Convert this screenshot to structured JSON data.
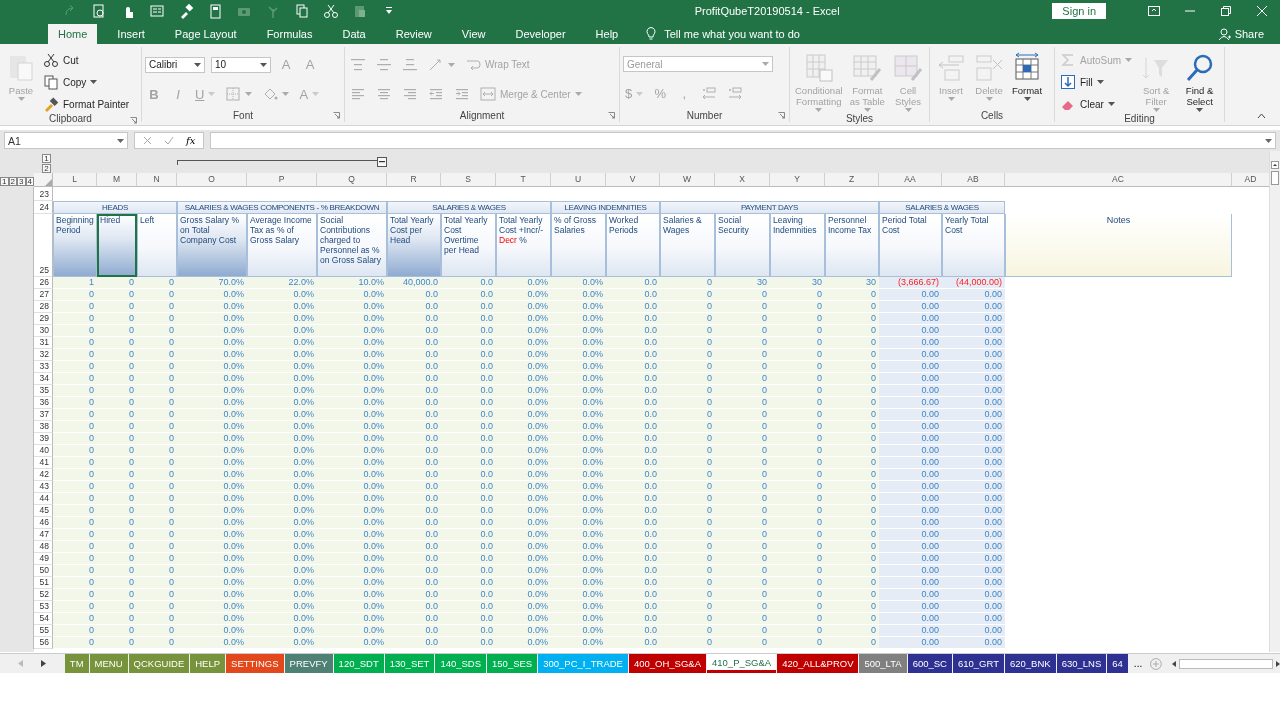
{
  "title_bar": {
    "title": "ProfitQubeT20190514  -  Excel",
    "sign_in": "Sign in"
  },
  "menu_tabs": [
    {
      "label": "Home",
      "selected": true
    },
    {
      "label": "Insert",
      "selected": false
    },
    {
      "label": "Page Layout",
      "selected": false
    },
    {
      "label": "Formulas",
      "selected": false
    },
    {
      "label": "Data",
      "selected": false
    },
    {
      "label": "Review",
      "selected": false
    },
    {
      "label": "View",
      "selected": false
    },
    {
      "label": "Developer",
      "selected": false
    },
    {
      "label": "Help",
      "selected": false
    }
  ],
  "tell_me": "Tell me what you want to do",
  "share": "Share",
  "ribbon": {
    "groups": [
      {
        "label": "Clipboard",
        "lines": [
          [
            {
              "kind": "large",
              "label": "Paste",
              "dropdown": true,
              "disabled": true
            }
          ],
          [
            {
              "kind": "small",
              "label": "Cut",
              "dropdown": false,
              "disabled": false
            },
            {
              "kind": "small",
              "label": "Copy",
              "dropdown": true,
              "disabled": false
            },
            {
              "kind": "small",
              "label": "Format Painter",
              "dropdown": false,
              "disabled": false
            }
          ]
        ]
      },
      {
        "label": "Font",
        "lines": [
          [
            {
              "kind": "field",
              "label": "Calibri",
              "dropdown": true,
              "disabled": false
            },
            {
              "kind": "field",
              "label": "10",
              "dropdown": true,
              "disabled": false
            },
            {
              "kind": "glyph",
              "label": "A",
              "dropdown": false,
              "disabled": true
            },
            {
              "kind": "glyph",
              "label": "A",
              "dropdown": false,
              "disabled": true
            }
          ],
          [
            {
              "kind": "glyph",
              "label": "B",
              "dropdown": false,
              "disabled": true
            },
            {
              "kind": "glyph",
              "label": "I",
              "dropdown": false,
              "disabled": true
            },
            {
              "kind": "glyph",
              "label": "U",
              "dropdown": true,
              "disabled": true
            },
            {
              "kind": "icon",
              "dropdown": true,
              "disabled": true
            },
            {
              "kind": "icon",
              "dropdown": true,
              "disabled": true
            },
            {
              "kind": "glyph",
              "label": "A",
              "dropdown": true,
              "disabled": true
            }
          ]
        ]
      },
      {
        "label": "Alignment",
        "lines": [
          [
            {
              "kind": "icon",
              "dropdown": false,
              "disabled": true
            },
            {
              "kind": "icon",
              "dropdown": false,
              "disabled": true
            },
            {
              "kind": "icon",
              "dropdown": false,
              "disabled": true
            },
            {
              "kind": "icon",
              "dropdown": true,
              "disabled": true
            },
            {
              "kind": "small",
              "label": "Wrap Text",
              "dropdown": false,
              "disabled": true
            }
          ],
          [
            {
              "kind": "icon",
              "dropdown": false,
              "disabled": true
            },
            {
              "kind": "icon",
              "dropdown": false,
              "disabled": true
            },
            {
              "kind": "icon",
              "dropdown": false,
              "disabled": true
            },
            {
              "kind": "icon",
              "dropdown": false,
              "disabled": true
            },
            {
              "kind": "icon",
              "dropdown": false,
              "disabled": true
            },
            {
              "kind": "small",
              "label": "Merge & Center",
              "dropdown": true,
              "disabled": true
            }
          ]
        ]
      },
      {
        "label": "Number",
        "lines": [
          [
            {
              "kind": "field",
              "label": "General",
              "dropdown": true,
              "disabled": true
            }
          ],
          [
            {
              "kind": "glyph",
              "label": "$",
              "dropdown": true,
              "disabled": true
            },
            {
              "kind": "glyph",
              "label": "%",
              "dropdown": false,
              "disabled": true
            },
            {
              "kind": "glyph",
              "label": ",",
              "dropdown": false,
              "disabled": true
            },
            {
              "kind": "icon",
              "dropdown": false,
              "disabled": true
            },
            {
              "kind": "icon",
              "dropdown": false,
              "disabled": true
            }
          ]
        ]
      },
      {
        "label": "Styles",
        "lines": [
          [
            {
              "kind": "large",
              "label": "Conditional Formatting",
              "dropdown": true,
              "disabled": true
            }
          ],
          [
            {
              "kind": "large",
              "label": "Format as Table",
              "dropdown": true,
              "disabled": true
            }
          ],
          [
            {
              "kind": "large",
              "label": "Cell Styles",
              "dropdown": true,
              "disabled": true
            }
          ]
        ]
      },
      {
        "label": "Cells",
        "lines": [
          [
            {
              "kind": "large",
              "label": "Insert",
              "dropdown": true,
              "disabled": true
            }
          ],
          [
            {
              "kind": "large",
              "label": "Delete",
              "dropdown": true,
              "disabled": true
            }
          ],
          [
            {
              "kind": "large",
              "label": "Format",
              "dropdown": true,
              "disabled": false
            }
          ]
        ]
      },
      {
        "label": "Editing",
        "lines": [
          [
            {
              "kind": "small",
              "label": "AutoSum",
              "dropdown": true,
              "disabled": true
            },
            {
              "kind": "small",
              "label": "Fill",
              "dropdown": true,
              "disabled": false
            },
            {
              "kind": "small",
              "label": "Clear",
              "dropdown": true,
              "disabled": false
            }
          ],
          [
            {
              "kind": "large",
              "label": "Sort & Filter",
              "dropdown": true,
              "disabled": true
            }
          ],
          [
            {
              "kind": "large",
              "label": "Find & Select",
              "dropdown": true,
              "disabled": false
            }
          ]
        ]
      }
    ]
  },
  "formula_bar": {
    "name_box": "A1",
    "fx": "fx"
  },
  "sheet": {
    "column_outline_levels": [
      "1",
      "2"
    ],
    "row_outline_levels": [
      "1",
      "2",
      "3",
      "4"
    ],
    "columns": [
      "L",
      "M",
      "N",
      "O",
      "P",
      "Q",
      "R",
      "S",
      "T",
      "U",
      "V",
      "W",
      "X",
      "Y",
      "Z",
      "AA",
      "AB",
      "AC",
      "AD"
    ],
    "empty_rows": [
      "23"
    ],
    "band_row": "24",
    "bands": [
      "HEADS",
      "SALARIES & WAGES COMPONENTS - % BREAKDOWN",
      "SALARIES & WAGES",
      "LEAVING INDEMNITIES",
      "PAYMENT DAYS",
      "SALARIES & WAGES"
    ],
    "header_row": "25",
    "headers": [
      {
        "label": "Beginning Period",
        "shaded": true,
        "selected": false
      },
      {
        "label": "Hired",
        "shaded": true,
        "selected": true
      },
      {
        "label": "Left",
        "shaded": false,
        "selected": false
      },
      {
        "label": "Gross Salary % on Total Company Cost",
        "shaded": true,
        "selected": false
      },
      {
        "label": "Average Income Tax as % of Gross Salary",
        "shaded": false,
        "selected": false
      },
      {
        "label": "Social Contributions charged to Personnel as % on Gross Salary",
        "shaded": false,
        "selected": false
      },
      {
        "label": "Total Yearly Cost per Head",
        "shaded": true,
        "selected": false
      },
      {
        "label": "Total Yearly Cost Overtime per Head",
        "shaded": false,
        "selected": false
      },
      {
        "label": "Total Yearly Cost +Incr/-",
        "alert": "Decr",
        "suffix": " %",
        "shaded": false,
        "selected": false
      },
      {
        "label": "% of Gross Salaries",
        "shaded": false,
        "selected": false
      },
      {
        "label": "Worked Periods",
        "shaded": false,
        "selected": false
      },
      {
        "label": "Salaries & Wages",
        "shaded": false,
        "selected": false
      },
      {
        "label": "Social Security",
        "shaded": false,
        "selected": false
      },
      {
        "label": "Leaving Indemnities",
        "shaded": false,
        "selected": false
      },
      {
        "label": "Personnel Income Tax",
        "shaded": false,
        "selected": false
      },
      {
        "label": "Period Total Cost",
        "shaded": false,
        "selected": false
      },
      {
        "label": "Yearly Total Cost",
        "shaded": false,
        "selected": false
      }
    ],
    "notes_header": "Notes",
    "rows": [
      {
        "row": "26",
        "cells": [
          "1",
          "0",
          "0",
          "70.0%",
          "22.0%",
          "10.0%",
          "40,000.0",
          "0.0",
          "0.0%",
          "0.0%",
          "0.0",
          "0",
          "30",
          "30",
          "30",
          {
            "value": "(3,666.67)",
            "negative": true
          },
          {
            "value": "(44,000.00)",
            "negative": true
          }
        ]
      },
      {
        "row": "27",
        "cells": [
          "0",
          "0",
          "0",
          "0.0%",
          "0.0%",
          "0.0%",
          "0.0",
          "0.0",
          "0.0%",
          "0.0%",
          "0.0",
          "0",
          "0",
          "0",
          "0",
          "0.00",
          "0.00"
        ]
      },
      {
        "row": "28",
        "cells": [
          "0",
          "0",
          "0",
          "0.0%",
          "0.0%",
          "0.0%",
          "0.0",
          "0.0",
          "0.0%",
          "0.0%",
          "0.0",
          "0",
          "0",
          "0",
          "0",
          "0.00",
          "0.00"
        ]
      },
      {
        "row": "29",
        "cells": [
          "0",
          "0",
          "0",
          "0.0%",
          "0.0%",
          "0.0%",
          "0.0",
          "0.0",
          "0.0%",
          "0.0%",
          "0.0",
          "0",
          "0",
          "0",
          "0",
          "0.00",
          "0.00"
        ]
      },
      {
        "row": "30",
        "cells": [
          "0",
          "0",
          "0",
          "0.0%",
          "0.0%",
          "0.0%",
          "0.0",
          "0.0",
          "0.0%",
          "0.0%",
          "0.0",
          "0",
          "0",
          "0",
          "0",
          "0.00",
          "0.00"
        ]
      },
      {
        "row": "31",
        "cells": [
          "0",
          "0",
          "0",
          "0.0%",
          "0.0%",
          "0.0%",
          "0.0",
          "0.0",
          "0.0%",
          "0.0%",
          "0.0",
          "0",
          "0",
          "0",
          "0",
          "0.00",
          "0.00"
        ]
      },
      {
        "row": "32",
        "cells": [
          "0",
          "0",
          "0",
          "0.0%",
          "0.0%",
          "0.0%",
          "0.0",
          "0.0",
          "0.0%",
          "0.0%",
          "0.0",
          "0",
          "0",
          "0",
          "0",
          "0.00",
          "0.00"
        ]
      },
      {
        "row": "33",
        "cells": [
          "0",
          "0",
          "0",
          "0.0%",
          "0.0%",
          "0.0%",
          "0.0",
          "0.0",
          "0.0%",
          "0.0%",
          "0.0",
          "0",
          "0",
          "0",
          "0",
          "0.00",
          "0.00"
        ]
      },
      {
        "row": "34",
        "cells": [
          "0",
          "0",
          "0",
          "0.0%",
          "0.0%",
          "0.0%",
          "0.0",
          "0.0",
          "0.0%",
          "0.0%",
          "0.0",
          "0",
          "0",
          "0",
          "0",
          "0.00",
          "0.00"
        ]
      },
      {
        "row": "35",
        "cells": [
          "0",
          "0",
          "0",
          "0.0%",
          "0.0%",
          "0.0%",
          "0.0",
          "0.0",
          "0.0%",
          "0.0%",
          "0.0",
          "0",
          "0",
          "0",
          "0",
          "0.00",
          "0.00"
        ]
      },
      {
        "row": "36",
        "cells": [
          "0",
          "0",
          "0",
          "0.0%",
          "0.0%",
          "0.0%",
          "0.0",
          "0.0",
          "0.0%",
          "0.0%",
          "0.0",
          "0",
          "0",
          "0",
          "0",
          "0.00",
          "0.00"
        ]
      },
      {
        "row": "37",
        "cells": [
          "0",
          "0",
          "0",
          "0.0%",
          "0.0%",
          "0.0%",
          "0.0",
          "0.0",
          "0.0%",
          "0.0%",
          "0.0",
          "0",
          "0",
          "0",
          "0",
          "0.00",
          "0.00"
        ]
      },
      {
        "row": "38",
        "cells": [
          "0",
          "0",
          "0",
          "0.0%",
          "0.0%",
          "0.0%",
          "0.0",
          "0.0",
          "0.0%",
          "0.0%",
          "0.0",
          "0",
          "0",
          "0",
          "0",
          "0.00",
          "0.00"
        ]
      },
      {
        "row": "39",
        "cells": [
          "0",
          "0",
          "0",
          "0.0%",
          "0.0%",
          "0.0%",
          "0.0",
          "0.0",
          "0.0%",
          "0.0%",
          "0.0",
          "0",
          "0",
          "0",
          "0",
          "0.00",
          "0.00"
        ]
      },
      {
        "row": "40",
        "cells": [
          "0",
          "0",
          "0",
          "0.0%",
          "0.0%",
          "0.0%",
          "0.0",
          "0.0",
          "0.0%",
          "0.0%",
          "0.0",
          "0",
          "0",
          "0",
          "0",
          "0.00",
          "0.00"
        ]
      },
      {
        "row": "41",
        "cells": [
          "0",
          "0",
          "0",
          "0.0%",
          "0.0%",
          "0.0%",
          "0.0",
          "0.0",
          "0.0%",
          "0.0%",
          "0.0",
          "0",
          "0",
          "0",
          "0",
          "0.00",
          "0.00"
        ]
      },
      {
        "row": "42",
        "cells": [
          "0",
          "0",
          "0",
          "0.0%",
          "0.0%",
          "0.0%",
          "0.0",
          "0.0",
          "0.0%",
          "0.0%",
          "0.0",
          "0",
          "0",
          "0",
          "0",
          "0.00",
          "0.00"
        ]
      },
      {
        "row": "43",
        "cells": [
          "0",
          "0",
          "0",
          "0.0%",
          "0.0%",
          "0.0%",
          "0.0",
          "0.0",
          "0.0%",
          "0.0%",
          "0.0",
          "0",
          "0",
          "0",
          "0",
          "0.00",
          "0.00"
        ]
      },
      {
        "row": "44",
        "cells": [
          "0",
          "0",
          "0",
          "0.0%",
          "0.0%",
          "0.0%",
          "0.0",
          "0.0",
          "0.0%",
          "0.0%",
          "0.0",
          "0",
          "0",
          "0",
          "0",
          "0.00",
          "0.00"
        ]
      },
      {
        "row": "45",
        "cells": [
          "0",
          "0",
          "0",
          "0.0%",
          "0.0%",
          "0.0%",
          "0.0",
          "0.0",
          "0.0%",
          "0.0%",
          "0.0",
          "0",
          "0",
          "0",
          "0",
          "0.00",
          "0.00"
        ]
      },
      {
        "row": "46",
        "cells": [
          "0",
          "0",
          "0",
          "0.0%",
          "0.0%",
          "0.0%",
          "0.0",
          "0.0",
          "0.0%",
          "0.0%",
          "0.0",
          "0",
          "0",
          "0",
          "0",
          "0.00",
          "0.00"
        ]
      },
      {
        "row": "47",
        "cells": [
          "0",
          "0",
          "0",
          "0.0%",
          "0.0%",
          "0.0%",
          "0.0",
          "0.0",
          "0.0%",
          "0.0%",
          "0.0",
          "0",
          "0",
          "0",
          "0",
          "0.00",
          "0.00"
        ]
      },
      {
        "row": "48",
        "cells": [
          "0",
          "0",
          "0",
          "0.0%",
          "0.0%",
          "0.0%",
          "0.0",
          "0.0",
          "0.0%",
          "0.0%",
          "0.0",
          "0",
          "0",
          "0",
          "0",
          "0.00",
          "0.00"
        ]
      },
      {
        "row": "49",
        "cells": [
          "0",
          "0",
          "0",
          "0.0%",
          "0.0%",
          "0.0%",
          "0.0",
          "0.0",
          "0.0%",
          "0.0%",
          "0.0",
          "0",
          "0",
          "0",
          "0",
          "0.00",
          "0.00"
        ]
      },
      {
        "row": "50",
        "cells": [
          "0",
          "0",
          "0",
          "0.0%",
          "0.0%",
          "0.0%",
          "0.0",
          "0.0",
          "0.0%",
          "0.0%",
          "0.0",
          "0",
          "0",
          "0",
          "0",
          "0.00",
          "0.00"
        ]
      },
      {
        "row": "51",
        "cells": [
          "0",
          "0",
          "0",
          "0.0%",
          "0.0%",
          "0.0%",
          "0.0",
          "0.0",
          "0.0%",
          "0.0%",
          "0.0",
          "0",
          "0",
          "0",
          "0",
          "0.00",
          "0.00"
        ]
      },
      {
        "row": "52",
        "cells": [
          "0",
          "0",
          "0",
          "0.0%",
          "0.0%",
          "0.0%",
          "0.0",
          "0.0",
          "0.0%",
          "0.0%",
          "0.0",
          "0",
          "0",
          "0",
          "0",
          "0.00",
          "0.00"
        ]
      },
      {
        "row": "53",
        "cells": [
          "0",
          "0",
          "0",
          "0.0%",
          "0.0%",
          "0.0%",
          "0.0",
          "0.0",
          "0.0%",
          "0.0%",
          "0.0",
          "0",
          "0",
          "0",
          "0",
          "0.00",
          "0.00"
        ]
      },
      {
        "row": "54",
        "cells": [
          "0",
          "0",
          "0",
          "0.0%",
          "0.0%",
          "0.0%",
          "0.0",
          "0.0",
          "0.0%",
          "0.0%",
          "0.0",
          "0",
          "0",
          "0",
          "0",
          "0.00",
          "0.00"
        ]
      },
      {
        "row": "55",
        "cells": [
          "0",
          "0",
          "0",
          "0.0%",
          "0.0%",
          "0.0%",
          "0.0",
          "0.0",
          "0.0%",
          "0.0%",
          "0.0",
          "0",
          "0",
          "0",
          "0",
          "0.00",
          "0.00"
        ]
      },
      {
        "row": "56",
        "cells": [
          "0",
          "0",
          "0",
          "0.0%",
          "0.0%",
          "0.0%",
          "0.0",
          "0.0",
          "0.0%",
          "0.0%",
          "0.0",
          "0",
          "0",
          "0",
          "0",
          "0.00",
          "0.00"
        ]
      }
    ]
  },
  "sheet_tabs": [
    {
      "label": "TM",
      "color": "#77933c",
      "selected": false
    },
    {
      "label": "MENU",
      "color": "#77933c",
      "selected": false
    },
    {
      "label": "QCKGUIDE",
      "color": "#77933c",
      "selected": false
    },
    {
      "label": "HELP",
      "color": "#77933c",
      "selected": false
    },
    {
      "label": "SETTINGS",
      "color": "#e2481c",
      "selected": false
    },
    {
      "label": "PREVFY",
      "color": "#4e8074",
      "selected": false
    },
    {
      "label": "120_SDT",
      "color": "#00b050",
      "selected": false
    },
    {
      "label": "130_SET",
      "color": "#00b050",
      "selected": false
    },
    {
      "label": "140_SDS",
      "color": "#00b050",
      "selected": false
    },
    {
      "label": "150_SES",
      "color": "#00b050",
      "selected": false
    },
    {
      "label": "300_PC_I_TRADE",
      "color": "#00b0f0",
      "selected": false
    },
    {
      "label": "400_OH_SG&A",
      "color": "#c00000",
      "selected": false
    },
    {
      "label": "410_P_SG&A",
      "color": "#c00000",
      "selected": true
    },
    {
      "label": "420_ALL&PROV",
      "color": "#c00000",
      "selected": false
    },
    {
      "label": "500_LTA",
      "color": "#808080",
      "selected": false
    },
    {
      "label": "600_SC",
      "color": "#2e3192",
      "selected": false
    },
    {
      "label": "610_GRT",
      "color": "#2e3192",
      "selected": false
    },
    {
      "label": "620_BNK",
      "color": "#2e3192",
      "selected": false
    },
    {
      "label": "630_LNS",
      "color": "#2e3192",
      "selected": false
    },
    {
      "label": "64",
      "color": "#2e3192",
      "selected": false
    }
  ],
  "more_tabs": "..."
}
